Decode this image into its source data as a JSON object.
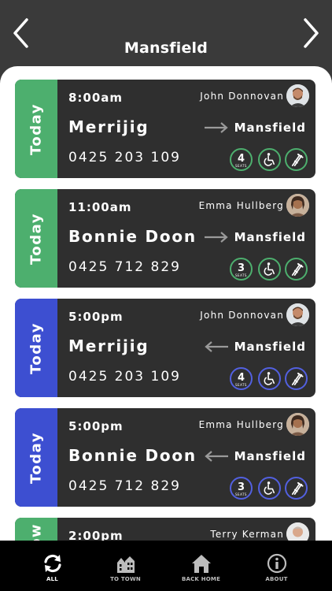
{
  "header": {
    "title": "Mansfield",
    "prev_icon": "chevron-left-icon",
    "next_icon": "chevron-right-icon"
  },
  "colors": {
    "today_outbound": "#4daf6e",
    "today_return": "#3d4fd1",
    "card_bg": "#2f2f2f",
    "tabbar_bg": "#000000"
  },
  "trips": [
    {
      "day": "Today",
      "time": "8:00am",
      "driver": "John Donnovan",
      "origin": "Merrijig",
      "destination": "Mansfield",
      "direction": "to",
      "phone": "0425 203 109",
      "seats": "4",
      "seats_label": "SEATS",
      "strip": "green"
    },
    {
      "day": "Today",
      "time": "11:00am",
      "driver": "Emma Hullberg",
      "origin": "Bonnie Doon",
      "destination": "Mansfield",
      "direction": "to",
      "phone": "0425 712 829",
      "seats": "3",
      "seats_label": "SEATS",
      "strip": "green"
    },
    {
      "day": "Today",
      "time": "5:00pm",
      "driver": "John Donnovan",
      "origin": "Merrijig",
      "destination": "Mansfield",
      "direction": "from",
      "phone": "0425 203 109",
      "seats": "4",
      "seats_label": "SEATS",
      "strip": "blue"
    },
    {
      "day": "Today",
      "time": "5:00pm",
      "driver": "Emma Hullberg",
      "origin": "Bonnie Doon",
      "destination": "Mansfield",
      "direction": "from",
      "phone": "0425 712 829",
      "seats": "3",
      "seats_label": "SEATS",
      "strip": "blue"
    },
    {
      "day": "Tomorrow",
      "time": "2:00pm",
      "driver": "Terry Kerman",
      "origin": "",
      "destination": "",
      "direction": "",
      "phone": "",
      "seats": "",
      "seats_label": "",
      "strip": "green"
    }
  ],
  "tabs": [
    {
      "label": "ALL",
      "icon": "refresh-icon",
      "active": true
    },
    {
      "label": "TO TOWN",
      "icon": "town-icon",
      "active": false
    },
    {
      "label": "BACK HOME",
      "icon": "home-icon",
      "active": false
    },
    {
      "label": "ABOUT",
      "icon": "info-icon",
      "active": false
    }
  ]
}
